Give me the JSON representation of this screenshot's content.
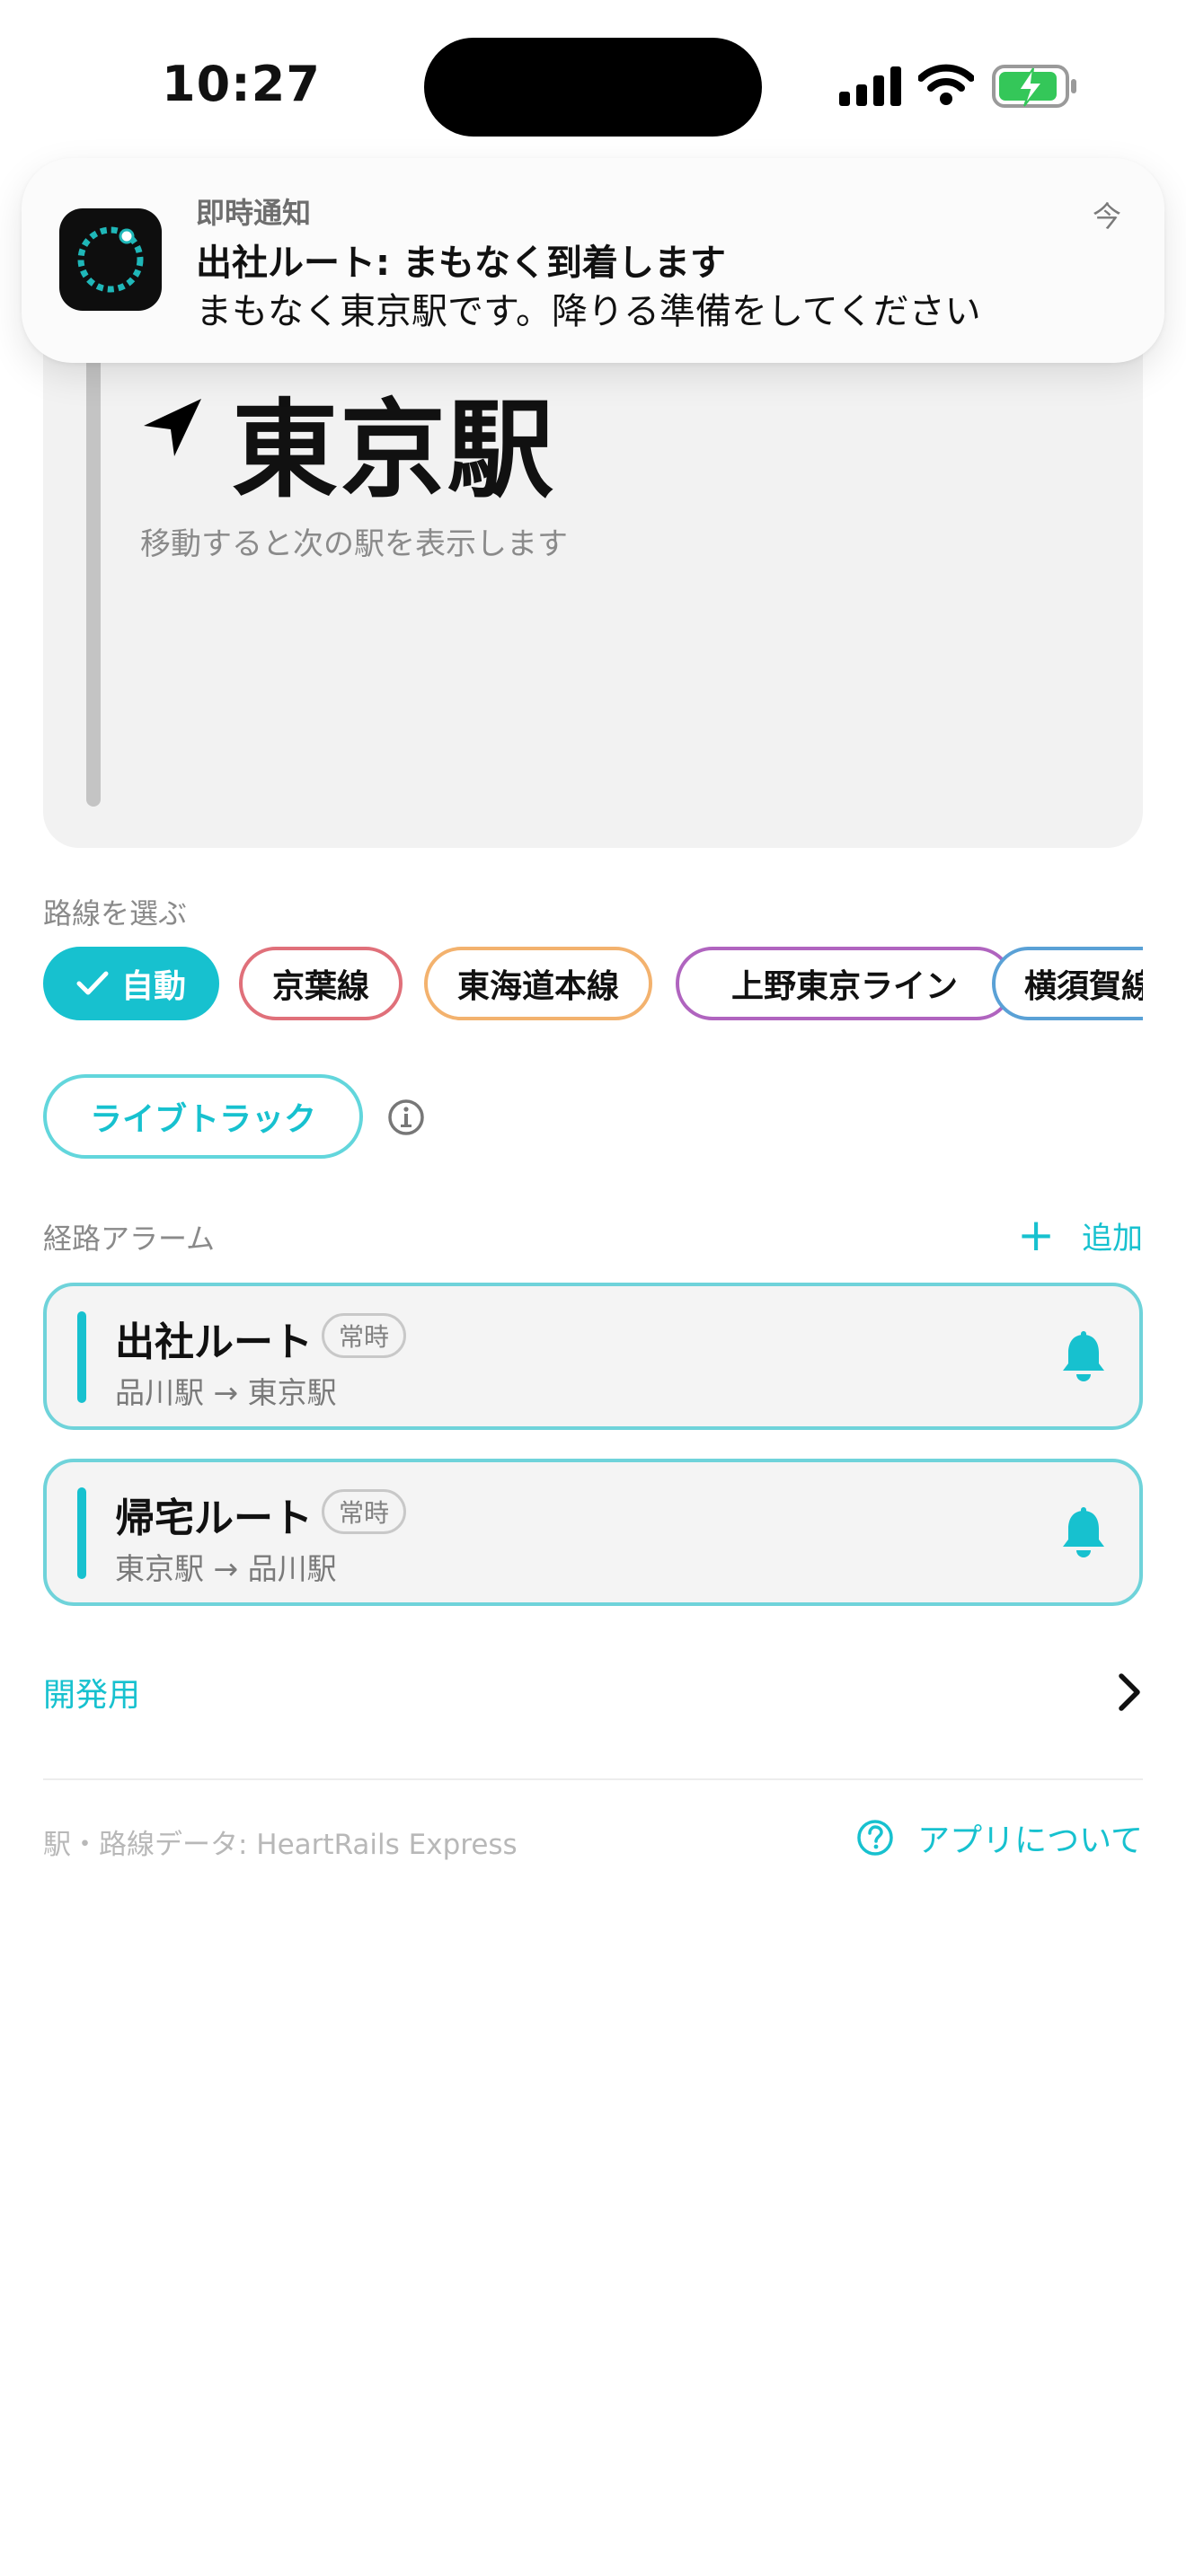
{
  "status_bar": {
    "time": "10:27"
  },
  "notification": {
    "app_name": "即時通知",
    "time": "今",
    "title": "出社ルート: まもなく到着します",
    "body": "まもなく東京駅です。降りる準備をしてください"
  },
  "station": {
    "name": "東京駅",
    "hint": "移動すると次の駅を表示します"
  },
  "lines": {
    "label": "路線を選ぶ",
    "chips": [
      {
        "label": "自動",
        "selected": true,
        "color": "#17c1cf"
      },
      {
        "label": "京葉線",
        "selected": false,
        "color": "#e0707a"
      },
      {
        "label": "東海道本線",
        "selected": false,
        "color": "#f3b26e"
      },
      {
        "label": "上野東京ライン",
        "selected": false,
        "color": "#b064bf"
      },
      {
        "label": "横須賀線",
        "selected": false,
        "color": "#5aa1d6"
      }
    ]
  },
  "live_track": {
    "label": "ライブトラック"
  },
  "route_alarms": {
    "label": "経路アラーム",
    "add_label": "追加",
    "routes": [
      {
        "name": "出社ルート",
        "badge": "常時",
        "path": "品川駅 → 東京駅"
      },
      {
        "name": "帰宅ルート",
        "badge": "常時",
        "path": "東京駅 → 品川駅"
      }
    ]
  },
  "developer": {
    "label": "開発用"
  },
  "footer": {
    "credit": "駅・路線データ: HeartRails Express",
    "about_label": "アプリについて"
  },
  "colors": {
    "accent": "#17c1cf",
    "card_border": "#6fd3da"
  },
  "icons": {
    "signal": "cellular-signal-icon",
    "wifi": "wifi-icon",
    "battery": "battery-charging-icon",
    "nav": "location-arrow-icon",
    "bell": "bell-icon",
    "info": "info-icon",
    "chevron": "chevron-right-icon",
    "question": "question-icon"
  }
}
